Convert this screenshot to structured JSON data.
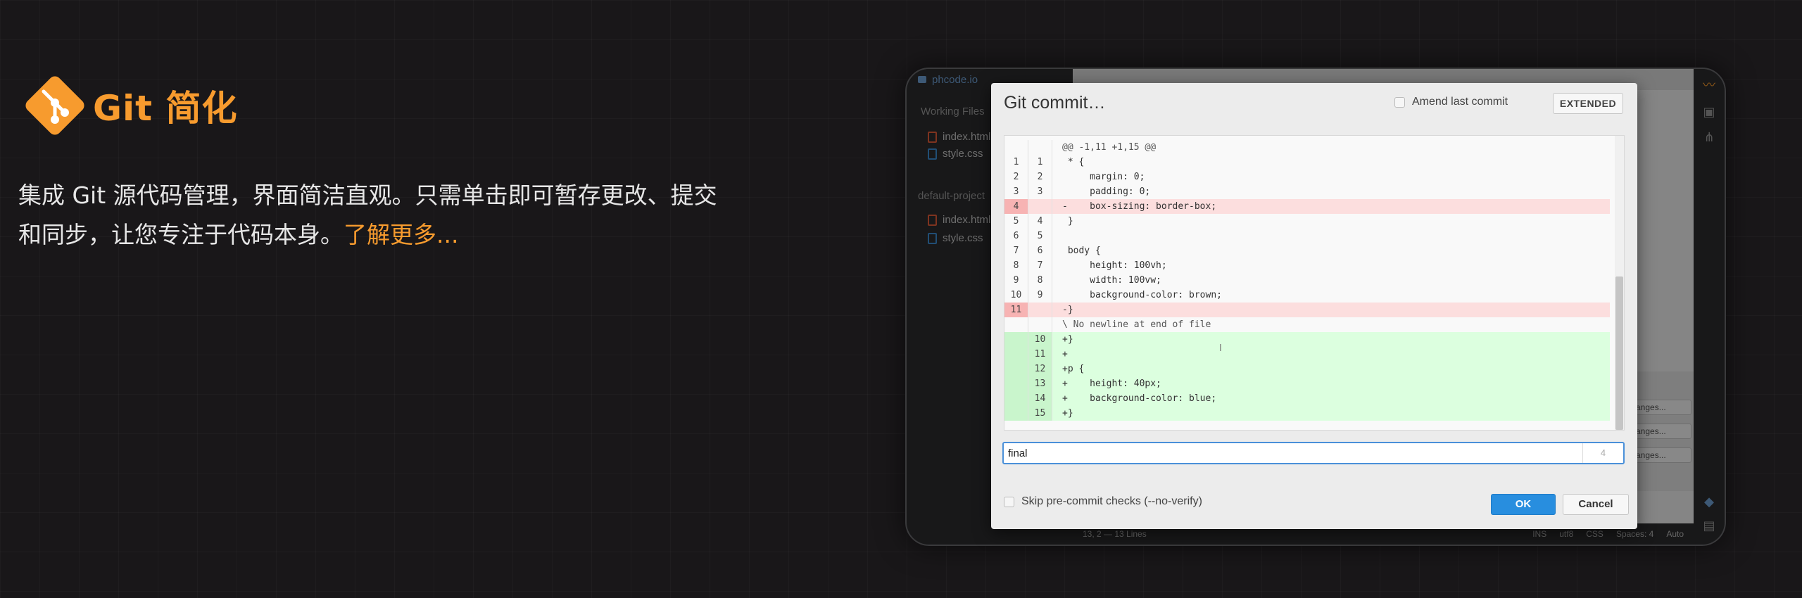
{
  "promo": {
    "title": "Git 简化",
    "description": "集成 Git 源代码管理，界面简洁直观。只需单击即可暂存更改、提交和同步，让您专注于代码本身。",
    "learn_more": "了解更多...",
    "logo_color": "#f79b2e"
  },
  "ide": {
    "project_name": "phcode.io",
    "working_files_label": "Working Files",
    "working_files": [
      {
        "name": "index.html",
        "icon": "html-file-icon"
      },
      {
        "name": "style.css",
        "icon": "css-file-icon"
      }
    ],
    "project_folder_label": "default-project",
    "project_files": [
      {
        "name": "index.html",
        "icon": "html-file-icon"
      },
      {
        "name": "style.css",
        "icon": "css-file-icon"
      }
    ],
    "git_changes": [
      "...anges...",
      "...anges...",
      "...anges..."
    ],
    "status": {
      "cursor": "13, 2 — 13 Lines",
      "ins": "INS",
      "encoding": "utf8",
      "language": "CSS",
      "spaces": "Spaces: 4",
      "auto": "Auto"
    }
  },
  "dialog": {
    "title": "Git commit…",
    "amend_label": "Amend last commit",
    "amend_checked": false,
    "extended_label": "EXTENDED",
    "diff": [
      {
        "old": "",
        "new": "",
        "code": "@@ -1,11 +1,15 @@",
        "type": "hunk"
      },
      {
        "old": "1",
        "new": "1",
        "code": " * {",
        "type": "ctx"
      },
      {
        "old": "2",
        "new": "2",
        "code": "     margin: 0;",
        "type": "ctx"
      },
      {
        "old": "3",
        "new": "3",
        "code": "     padding: 0;",
        "type": "ctx"
      },
      {
        "old": "4",
        "new": "",
        "code": "-    box-sizing: border-box;",
        "type": "del"
      },
      {
        "old": "5",
        "new": "4",
        "code": " }",
        "type": "ctx"
      },
      {
        "old": "6",
        "new": "5",
        "code": "",
        "type": "ctx"
      },
      {
        "old": "7",
        "new": "6",
        "code": " body {",
        "type": "ctx"
      },
      {
        "old": "8",
        "new": "7",
        "code": "     height: 100vh;",
        "type": "ctx"
      },
      {
        "old": "9",
        "new": "8",
        "code": "     width: 100vw;",
        "type": "ctx"
      },
      {
        "old": "10",
        "new": "9",
        "code": "     background-color: brown;",
        "type": "ctx"
      },
      {
        "old": "11",
        "new": "",
        "code": "-}",
        "type": "del"
      },
      {
        "old": "",
        "new": "",
        "code": "\\ No newline at end of file",
        "type": "note"
      },
      {
        "old": "",
        "new": "10",
        "code": "+}",
        "type": "add"
      },
      {
        "old": "",
        "new": "11",
        "code": "+",
        "type": "add"
      },
      {
        "old": "",
        "new": "12",
        "code": "+p {",
        "type": "add"
      },
      {
        "old": "",
        "new": "13",
        "code": "+    height: 40px;",
        "type": "add"
      },
      {
        "old": "",
        "new": "14",
        "code": "+    background-color: blue;",
        "type": "add"
      },
      {
        "old": "",
        "new": "15",
        "code": "+}",
        "type": "add"
      }
    ],
    "message_value": "final",
    "message_count": "4",
    "skip_label": "Skip pre-commit checks (--no-verify)",
    "skip_checked": false,
    "ok_label": "OK",
    "cancel_label": "Cancel"
  }
}
